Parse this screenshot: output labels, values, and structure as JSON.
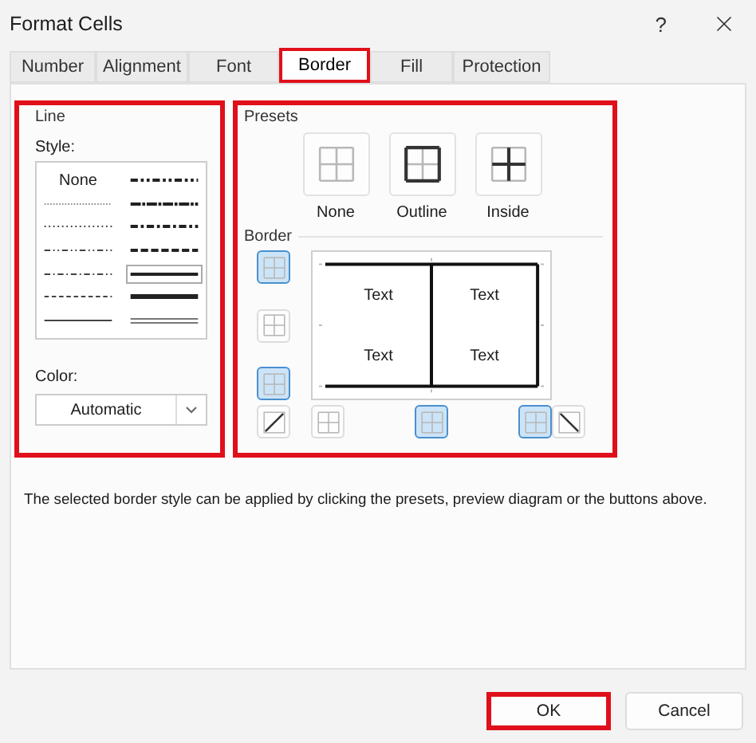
{
  "window": {
    "title": "Format Cells",
    "help": "?"
  },
  "tabs": [
    {
      "label": "Number",
      "selected": false,
      "highlighted": false
    },
    {
      "label": "Alignment",
      "selected": false,
      "highlighted": false
    },
    {
      "label": "Font",
      "selected": false,
      "highlighted": false
    },
    {
      "label": "Border",
      "selected": true,
      "highlighted": true
    },
    {
      "label": "Fill",
      "selected": false,
      "highlighted": false
    },
    {
      "label": "Protection",
      "selected": false,
      "highlighted": false
    }
  ],
  "line": {
    "title": "Line",
    "highlighted": true,
    "style_label": "Style:",
    "styles": [
      {
        "kind": "none",
        "label": "None",
        "selected": false
      },
      {
        "kind": "mediumDashDotDot",
        "selected": false
      },
      {
        "kind": "hair",
        "selected": false
      },
      {
        "kind": "slantDashDot",
        "selected": false
      },
      {
        "kind": "dotted",
        "selected": false
      },
      {
        "kind": "mediumDashDot",
        "selected": false
      },
      {
        "kind": "dashDotDot",
        "selected": false
      },
      {
        "kind": "mediumDashed",
        "selected": false
      },
      {
        "kind": "dashDot",
        "selected": false
      },
      {
        "kind": "medium",
        "selected": true
      },
      {
        "kind": "dashed",
        "selected": false
      },
      {
        "kind": "thick",
        "selected": false
      },
      {
        "kind": "thin",
        "selected": false
      },
      {
        "kind": "double",
        "selected": false
      }
    ],
    "color_label": "Color:",
    "color_value": "Automatic"
  },
  "presets_and_border": {
    "highlighted": true,
    "presets": {
      "title": "Presets",
      "items": [
        {
          "kind": "none",
          "label": "None"
        },
        {
          "kind": "outline",
          "label": "Outline"
        },
        {
          "kind": "inside",
          "label": "Inside"
        }
      ]
    },
    "border": {
      "title": "Border",
      "buttons": [
        {
          "kind": "top",
          "selected": true
        },
        {
          "kind": "middle_h",
          "selected": false
        },
        {
          "kind": "bottom",
          "selected": true
        },
        {
          "kind": "diag_up",
          "selected": false
        },
        {
          "kind": "left",
          "selected": false
        },
        {
          "kind": "middle_v",
          "selected": true
        },
        {
          "kind": "right",
          "selected": true
        },
        {
          "kind": "diag_down",
          "selected": false
        }
      ],
      "preview_cells": [
        "Text",
        "Text",
        "Text",
        "Text"
      ]
    }
  },
  "description": "The selected border style can be applied by clicking the presets, preview diagram or the buttons above.",
  "buttons": [
    {
      "label": "OK",
      "highlighted": true
    },
    {
      "label": "Cancel",
      "highlighted": false
    }
  ]
}
